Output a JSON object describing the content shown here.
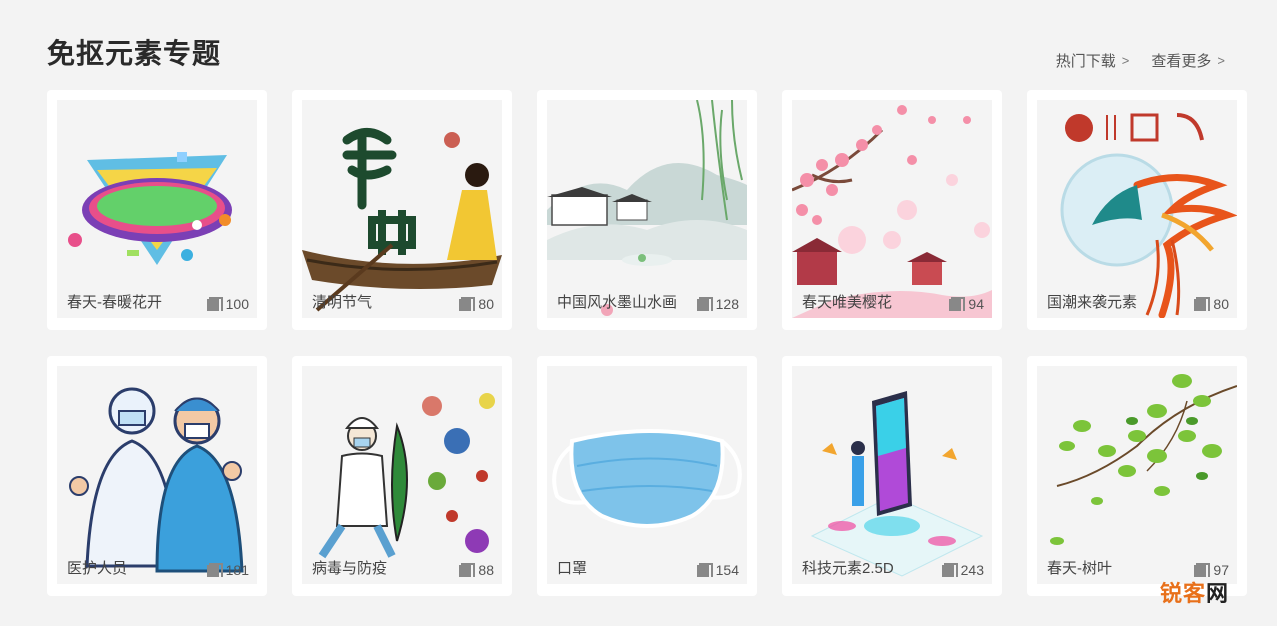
{
  "header": {
    "title": "免抠元素专题",
    "links": [
      {
        "label": "热门下载",
        "chev": ">"
      },
      {
        "label": "查看更多",
        "chev": ">"
      }
    ]
  },
  "cards": [
    {
      "name": "春天-春暖花开",
      "count": "100",
      "icon": "spring-text-art"
    },
    {
      "name": "清明节气",
      "count": "80",
      "icon": "qingming-boat-art"
    },
    {
      "name": "中国风水墨山水画",
      "count": "128",
      "icon": "ink-landscape-art"
    },
    {
      "name": "春天唯美樱花",
      "count": "94",
      "icon": "cherry-blossom-art"
    },
    {
      "name": "国潮来袭元素",
      "count": "80",
      "icon": "phoenix-art"
    },
    {
      "name": "医护人员",
      "count": "181",
      "icon": "medical-staff-art"
    },
    {
      "name": "病毒与防疫",
      "count": "88",
      "icon": "virus-defense-art"
    },
    {
      "name": "口罩",
      "count": "154",
      "icon": "face-mask-art"
    },
    {
      "name": "科技元素2.5D",
      "count": "243",
      "icon": "tech-isometric-art"
    },
    {
      "name": "春天-树叶",
      "count": "97",
      "icon": "green-leaves-art"
    }
  ],
  "watermark": {
    "part1": "锐客",
    "part2": "网"
  }
}
